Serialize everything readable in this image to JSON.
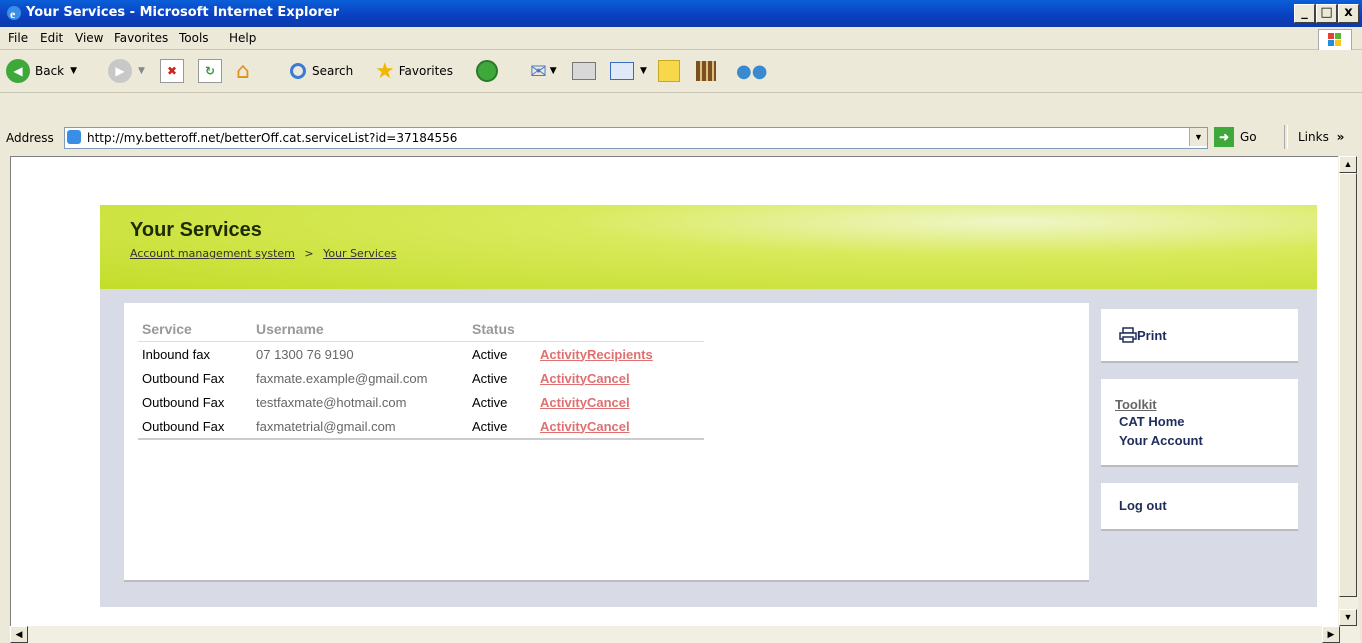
{
  "window": {
    "title": "Your Services - Microsoft Internet Explorer",
    "buttons": [
      "_",
      "□",
      "x"
    ]
  },
  "menu": {
    "items": [
      {
        "label": "File",
        "key": "F"
      },
      {
        "label": "Edit",
        "key": "E"
      },
      {
        "label": "View",
        "key": "V"
      },
      {
        "label": "Favorites",
        "key": "a"
      },
      {
        "label": "Tools",
        "key": "T"
      },
      {
        "label": "Help",
        "key": "H"
      }
    ]
  },
  "toolbar": {
    "back_label": "Back",
    "search_label": "Search",
    "favorites_label": "Favorites"
  },
  "address": {
    "label": "Address",
    "url": "http://my.betteroff.net/betterOff.cat.serviceList?id=37184556",
    "go_label": "Go",
    "links_label": "Links"
  },
  "page": {
    "title": "Your Services",
    "breadcrumb": [
      "Account management system",
      "Your Services"
    ],
    "breadcrumb_sep": ">",
    "table": {
      "headers": [
        "Service",
        "Username",
        "Status"
      ],
      "rows": [
        {
          "service": "Inbound fax",
          "username": "07 1300 76 9190",
          "status": "Active",
          "actions": [
            "Activity",
            "Recipients"
          ]
        },
        {
          "service": "Outbound Fax",
          "username": "faxmate.example@gmail.com",
          "status": "Active",
          "actions": [
            "Activity",
            "Cancel"
          ]
        },
        {
          "service": "Outbound Fax",
          "username": "testfaxmate@hotmail.com",
          "status": "Active",
          "actions": [
            "Activity",
            "Cancel"
          ]
        },
        {
          "service": "Outbound Fax",
          "username": "faxmatetrial@gmail.com",
          "status": "Active",
          "actions": [
            "Activity",
            "Cancel"
          ]
        }
      ]
    },
    "sidebar": {
      "print_label": "Print",
      "toolkit_label": "Toolkit",
      "links": [
        "CAT Home",
        "Your Account"
      ],
      "logout_label": "Log out"
    }
  },
  "colors": {
    "banner": "#c3dd2a",
    "link_action": "#e07070",
    "sidebar_link": "#1f2d5a",
    "panel_bg": "#d8dbe5"
  }
}
